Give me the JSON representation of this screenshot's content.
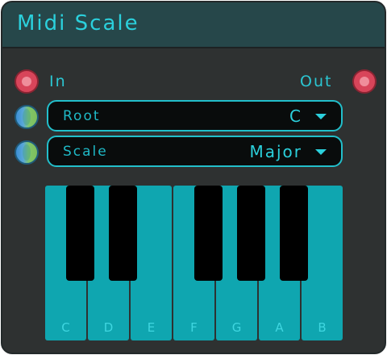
{
  "node": {
    "title": "Midi Scale",
    "ports": {
      "in_label": "In",
      "out_label": "Out"
    },
    "root": {
      "label": "Root",
      "value": "C"
    },
    "scale": {
      "label": "Scale",
      "value": "Major"
    },
    "keyboard": {
      "white_keys": [
        "C",
        "D",
        "E",
        "F",
        "G",
        "A",
        "B"
      ]
    }
  },
  "colors": {
    "accent": "#2bd0dc",
    "key": "#0fa6b0",
    "port": "#d8455a"
  },
  "icons": {
    "input_port": "red-port-icon",
    "output_port": "red-port-icon",
    "param_port": "globe-port-icon",
    "dropdown": "caret-down-icon"
  }
}
